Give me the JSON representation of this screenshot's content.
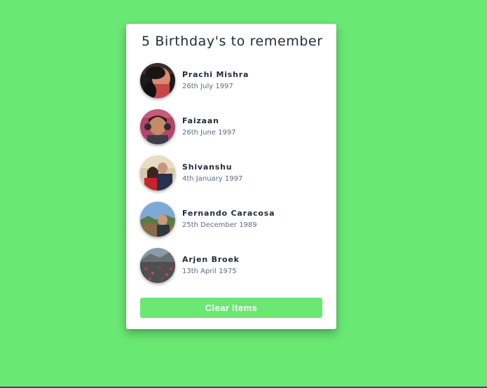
{
  "card": {
    "title": "5 Birthday's to remember"
  },
  "people": [
    {
      "name": "Prachi Mishra",
      "date": "26th July 1997",
      "avatar": "portrait-dark"
    },
    {
      "name": "Faizaan",
      "date": "26th June 1997",
      "avatar": "portrait-headphones"
    },
    {
      "name": "Shivanshu",
      "date": "4th January 1997",
      "avatar": "couple-portrait"
    },
    {
      "name": "Fernando Caracosa",
      "date": "25th December 1989",
      "avatar": "outdoor-portrait"
    },
    {
      "name": "Arjen Broek",
      "date": "13th April 1975",
      "avatar": "landscape-photo"
    }
  ],
  "actions": {
    "clear_label": "Clear Items"
  },
  "colors": {
    "background": "#6ae874",
    "card": "#ffffff",
    "button": "#6ae874",
    "name_text": "#1f2a3c",
    "date_text": "#5a6c83"
  }
}
